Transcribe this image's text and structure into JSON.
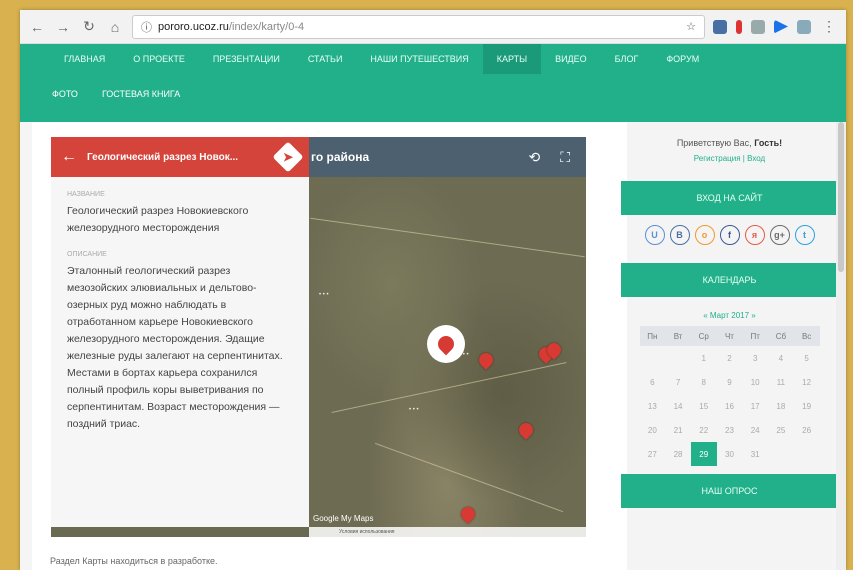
{
  "browser": {
    "url_host": "pororo.ucoz.ru",
    "url_path": "/index/karty/0-4"
  },
  "nav": {
    "row1": [
      "Главная",
      "О проекте",
      "Презентации",
      "Статьи",
      "Наши путешествия",
      "Карты",
      "Видео",
      "Блог",
      "Форум"
    ],
    "active": "Карты",
    "row2": [
      "Фото",
      "Гостевая книга"
    ]
  },
  "map": {
    "panel_title": "Геологический разрез Новок...",
    "header_title": "го района",
    "field1_label": "Название",
    "field1_value": "Геологический разрез Новокиевского железорудного месторождения",
    "field2_label": "Описание",
    "field2_value": "Эталонный геологический разрез мезозойских элювиальных и дельтово-озерных руд можно наблюдать в отработанном карьере Новокиевского железорудного месторождения. Эдащие железные руды залегают на серпентинитах. Местами в бортах карьера сохранился полный профиль коры выветривания по серпентинитам. Возраст месторождения — поздний триас.",
    "google": "Google My Maps",
    "footer": "Условия использования"
  },
  "notice": "Раздел Карты находиться в разработке.",
  "sidebar": {
    "greeting_prefix": "Приветствую Вас,",
    "greeting_user": "Гость!",
    "links": "Регистрация | Вход",
    "login_title": "Вход на сайт",
    "social": [
      {
        "label": "U",
        "color": "#5b8fd6",
        "icon": "ucoz-icon"
      },
      {
        "label": "B",
        "color": "#4a6fa5",
        "icon": "vk-icon"
      },
      {
        "label": "o",
        "color": "#f09a2a",
        "icon": "ok-icon"
      },
      {
        "label": "f",
        "color": "#3b5998",
        "icon": "facebook-icon"
      },
      {
        "label": "я",
        "color": "#e85a4a",
        "icon": "yandex-icon"
      },
      {
        "label": "g+",
        "color": "#6a6a6a",
        "icon": "google-icon"
      },
      {
        "label": "t",
        "color": "#2aa3e0",
        "icon": "twitter-icon"
      }
    ],
    "calendar_title": "Календарь",
    "calendar_month": "« Март 2017 »",
    "weekdays": [
      "Пн",
      "Вт",
      "Ср",
      "Чт",
      "Пт",
      "Сб",
      "Вс"
    ],
    "weeks": [
      [
        "",
        "",
        "1",
        "2",
        "3",
        "4",
        "5"
      ],
      [
        "6",
        "7",
        "8",
        "9",
        "10",
        "11",
        "12"
      ],
      [
        "13",
        "14",
        "15",
        "16",
        "17",
        "18",
        "19"
      ],
      [
        "20",
        "21",
        "22",
        "23",
        "24",
        "25",
        "26"
      ],
      [
        "27",
        "28",
        "29",
        "30",
        "31",
        "",
        ""
      ]
    ],
    "today": "29",
    "poll_title": "Наш опрос"
  },
  "colors": {
    "accent": "#21b08a",
    "map_panel_red": "#d4443b"
  }
}
